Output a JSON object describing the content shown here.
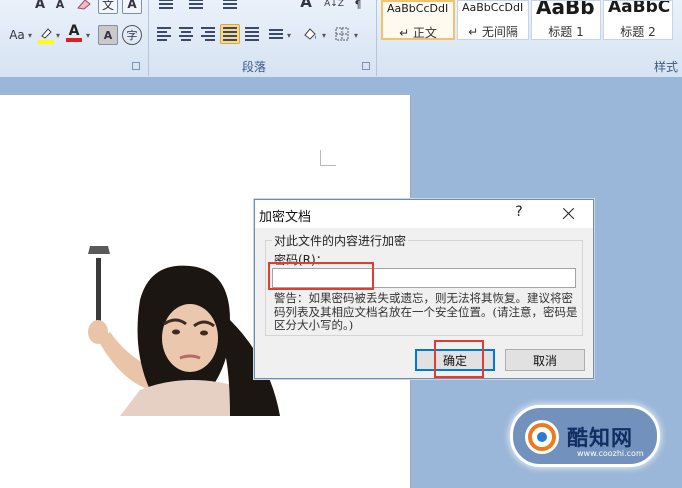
{
  "ribbon": {
    "groups": {
      "paragraph_label": "段落",
      "styles_label": "样式"
    },
    "buttons": {
      "font_a_large": "A",
      "font_a_small": "A",
      "wen": "文",
      "a_boxed": "A",
      "aa": "Aa",
      "a_red": "A",
      "a_shaded": "A",
      "zi_circle": "字",
      "sort_az": "A↓Z"
    },
    "styles": [
      {
        "sample": "AaBbCcDdI",
        "name": "↵ 正文"
      },
      {
        "sample": "AaBbCcDdI",
        "name": "↵ 无间隔"
      },
      {
        "sample": "AaBb",
        "name": "标题 1"
      },
      {
        "sample": "AaBbC",
        "name": "标题 2"
      }
    ]
  },
  "dialog": {
    "title": "加密文档",
    "help": "?",
    "group_label": "对此文件的内容进行加密",
    "password_label": "密码(R)：",
    "password_value": "",
    "warning": "警告：如果密码被丢失或遗忘，则无法将其恢复。建议将密码列表及其相应文档名放在一个安全位置。(请注意，密码是区分大小写的。)",
    "ok_label": "确定",
    "cancel_label": "取消"
  },
  "watermark": {
    "text": "酷知网",
    "url": "www.coozhi.com"
  },
  "colors": {
    "highlight": "#e23b2f",
    "ribbon_bg": "#d6e3f3",
    "default_button_border": "#0078d7"
  }
}
